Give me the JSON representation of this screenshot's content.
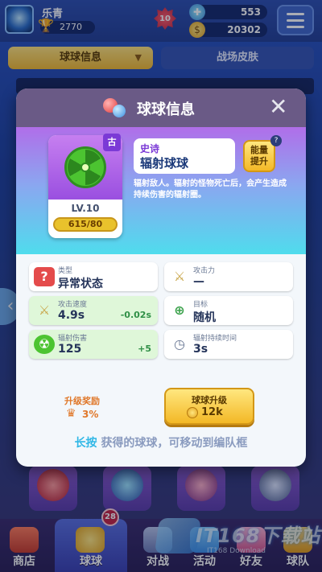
{
  "player": {
    "name": "乐青",
    "trophies": "2770",
    "gem_level": "10"
  },
  "resources": {
    "gems": "553",
    "coins": "20302"
  },
  "tabs": {
    "ball_info": "球球信息",
    "battle_skin": "战场皮肤"
  },
  "modal": {
    "title": "球球信息",
    "close": "✕",
    "ball": {
      "rarity_badge": "古",
      "rarity": "史诗",
      "name": "辐射球球",
      "level": "LV.10",
      "progress": "615/80",
      "upgrade_button": "能量\n提升",
      "upgrade_help": "?",
      "description": "辐射敌人。辐射的怪物死亡后，会产生造成持续伤害的辐射圈。"
    },
    "stats": [
      {
        "label": "类型",
        "value": "异常状态",
        "delta": "",
        "icon": "question-icon"
      },
      {
        "label": "攻击力",
        "value": "—",
        "delta": "",
        "icon": "sword-icon"
      },
      {
        "label": "攻击速度",
        "value": "4.9s",
        "delta": "-0.02s",
        "icon": "crossed-swords-icon"
      },
      {
        "label": "目标",
        "value": "随机",
        "delta": "",
        "icon": "target-icon"
      },
      {
        "label": "辐射伤害",
        "value": "125",
        "delta": "+5",
        "icon": "radiation-icon"
      },
      {
        "label": "辐射持续时间",
        "value": "3s",
        "delta": "",
        "icon": "clock-icon"
      }
    ],
    "reward": {
      "label": "升级奖励",
      "value": "3%"
    },
    "upgrade": {
      "label": "球球升级",
      "cost": "12k"
    },
    "hint": {
      "highlight": "长按",
      "text": "获得的球球，可移动到编队框"
    }
  },
  "nav": {
    "items": [
      "商店",
      "球球",
      "对战",
      "活动",
      "好友",
      "球队"
    ],
    "badge": "28"
  },
  "watermark": {
    "brand": "IT168下载站",
    "sub": "IT168 Download"
  },
  "colors": {
    "accent_gold": "#f3b826",
    "epic_purple": "#7b3ad6",
    "header": "#6a5a86"
  }
}
